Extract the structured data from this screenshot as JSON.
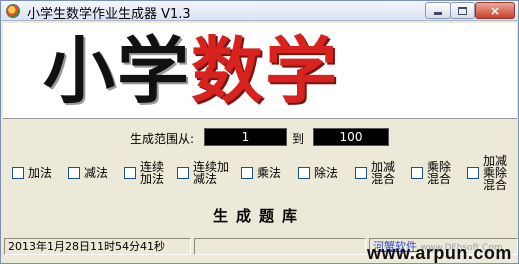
{
  "window": {
    "title": "小学生数学作业生成器 V1.3",
    "buttons": {
      "minimize": "minimize",
      "maximize": "maximize",
      "close": "×"
    }
  },
  "banner": {
    "text_black": "小学",
    "text_red": "数学"
  },
  "range": {
    "label": "生成范围从:",
    "from": "1",
    "separator": "到",
    "to": "100"
  },
  "options": [
    {
      "label": "加法",
      "checked": false
    },
    {
      "label": "减法",
      "checked": false
    },
    {
      "label": "连续\n加法",
      "checked": false
    },
    {
      "label": "连续加\n减法",
      "checked": false
    },
    {
      "label": "乘法",
      "checked": false
    },
    {
      "label": "除法",
      "checked": false
    },
    {
      "label": "加减\n混合",
      "checked": false
    },
    {
      "label": "乘除\n混合",
      "checked": false
    },
    {
      "label": "加减\n乘除\n混合",
      "checked": false
    }
  ],
  "generate_label": "生成题库",
  "status": {
    "time": "2013年1月28日11时54分41秒",
    "middle": "",
    "link_text": "河蟹软件",
    "link_url": "www.DFhsoft.Com"
  },
  "watermark": "www.arpun.com",
  "colors": {
    "banner_red": "#d8221e",
    "range_box_bg": "#000000",
    "window_bg": "#ece9d8"
  }
}
